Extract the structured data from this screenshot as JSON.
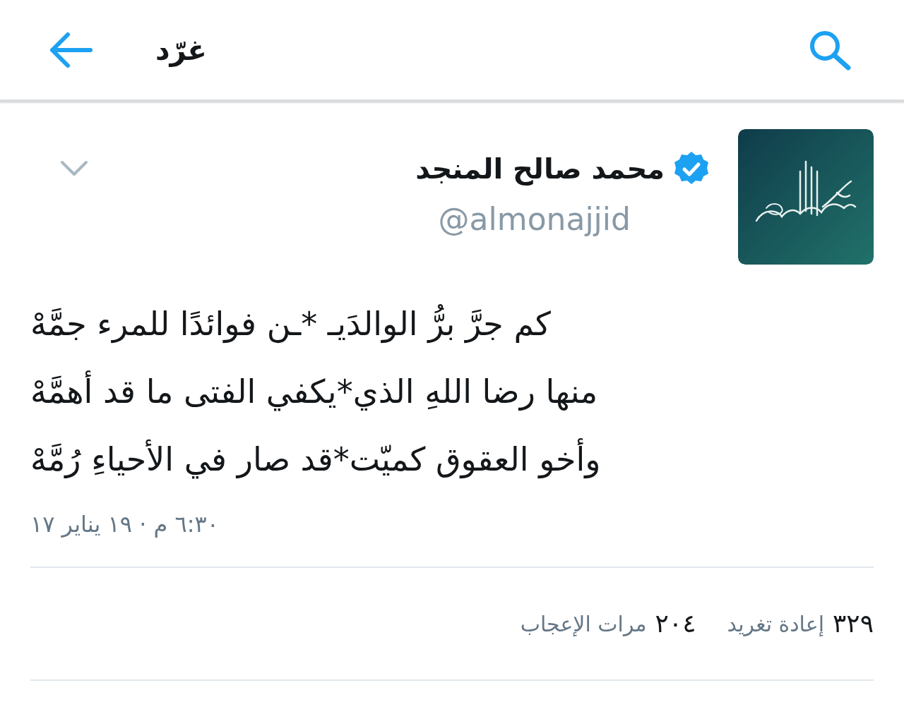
{
  "header": {
    "title": "غرّد"
  },
  "tweet": {
    "name": "محمد صالح المنجد",
    "verified": true,
    "handle": "@almonajjid",
    "lines": [
      "كم جرَّ برُّ الوالدَيـ *ـن فوائدًا للمرء جمَّهْ",
      "منها رضا اللهِ الذي*يكفي الفتى ما قد أهمَّهْ",
      "وأخو العقوق كميّت*قد صار في الأحياءِ رُمَّهْ"
    ],
    "timestamp": "٦:٣٠ م · ١٩ يناير ١٧",
    "stats": [
      {
        "count": "٣٢٩",
        "label": "إعادة تغريد"
      },
      {
        "count": "٢٠٤",
        "label": "مرات الإعجاب"
      }
    ]
  }
}
